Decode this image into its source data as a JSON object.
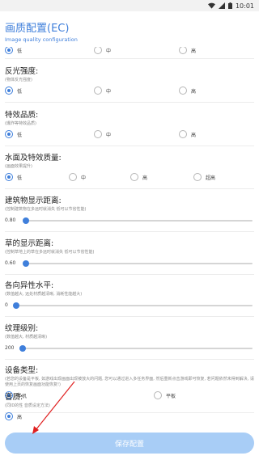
{
  "status_bar": {
    "time": "10:01"
  },
  "header": {
    "title": "画质配置(EC)",
    "subtitle": "Image quality configuration"
  },
  "sections": [
    {
      "key": "top_partial",
      "options": [
        "低",
        "中",
        "高"
      ],
      "selected": 0
    },
    {
      "key": "reflection",
      "title": "反光强度:",
      "subtitle": "(物体反光强度)",
      "options": [
        "低",
        "中",
        "高"
      ],
      "selected": 0
    },
    {
      "key": "effects",
      "title": "特效品质:",
      "subtitle": "(爆炸等特效品质)",
      "options": [
        "低",
        "中",
        "高"
      ],
      "selected": 0
    },
    {
      "key": "water",
      "title": "水面及特效质量:",
      "subtitle": "(画面效果提升)",
      "options": [
        "低",
        "中",
        "高",
        "超高"
      ],
      "selected": 0
    },
    {
      "key": "building_distance",
      "title": "建筑物显示距离:",
      "subtitle": "(控制建筑物在多远时就消失 低可以节省性能)",
      "value": "0.80",
      "level": 0.0
    },
    {
      "key": "grass_distance",
      "title": "草的显示距离:",
      "subtitle": "(控制草地上的草在多远时就消失 低可以节省性能)",
      "value": "0.60",
      "level": 0.0
    },
    {
      "key": "anisotropic",
      "title": "各向异性水平:",
      "subtitle": "(数值越大, 远处材质越清晰, 消耗性能越大)",
      "value": "0",
      "level": 0.0
    },
    {
      "key": "texture",
      "title": "纹理级别:",
      "subtitle": "(数值越大, 材质越清晰)",
      "value": "200",
      "level": 0.0
    },
    {
      "key": "device_type",
      "title": "设备类型:",
      "subtitle": "(若您的设备是平板, 如游戏出现画面出现被放大的问题, 您可以通过进入多任务界面, 然后重新点击游戏即可恢复, 若问题依然未得到解决, 请使用上页的恢复画面功能恢复!)",
      "options": [
        "手机",
        "平板"
      ],
      "selected": 0
    },
    {
      "key": "sound",
      "title": "音质:",
      "subtitle": "(同ID的性 音质设定方法)",
      "options": [
        "高"
      ],
      "selected": 0
    }
  ],
  "save_button": {
    "label": "保存配置"
  },
  "colors": {
    "accent": "#3f7fdb",
    "button_bg": "#a8cdf6",
    "annotation_arrow": "#e02020"
  }
}
